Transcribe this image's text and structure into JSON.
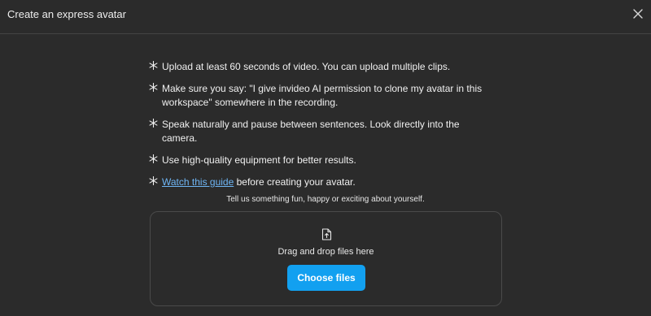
{
  "dialog": {
    "title": "Create an express avatar",
    "close_icon": "close-icon"
  },
  "tips": [
    {
      "text": "Upload at least 60 seconds of video. You can upload multiple clips."
    },
    {
      "text": "Make sure you say: \"I give invideo AI permission to clone my avatar in this workspace\" somewhere in the recording."
    },
    {
      "text": "Speak naturally and pause between sentences. Look directly into the camera."
    },
    {
      "text": "Use high-quality equipment for better results."
    },
    {
      "link": "Watch this guide",
      "text": " before creating your avatar."
    }
  ],
  "tip_icon": "star-icon",
  "upload": {
    "prompt": "Tell us something fun, happy or exciting about yourself.",
    "icon": "file-upload-icon",
    "drop_text": "Drag and drop files here",
    "button_label": "Choose files"
  },
  "colors": {
    "background": "#2b2b2b",
    "accent": "#12a0f0",
    "link": "#6fb6f5",
    "border": "#4a4a4a"
  }
}
